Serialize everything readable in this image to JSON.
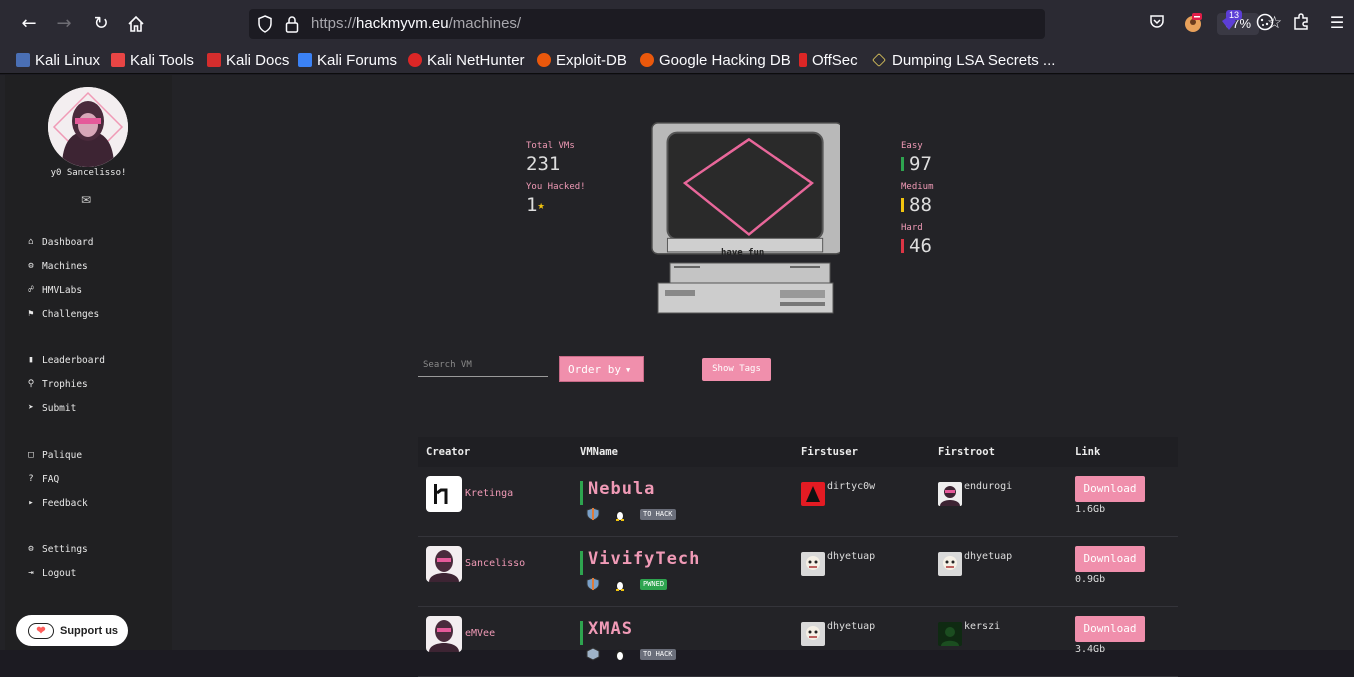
{
  "browser": {
    "url_scheme": "https://",
    "url_host": "hackmyvm.eu",
    "url_path": "/machines/",
    "zoom": "67%",
    "ext_badge": "13"
  },
  "bookmarks": [
    "Kali Linux",
    "Kali Tools",
    "Kali Docs",
    "Kali Forums",
    "Kali NetHunter",
    "Exploit-DB",
    "Google Hacking DB",
    "OffSec",
    "Dumping LSA Secrets ..."
  ],
  "sidebar": {
    "username": "y0 Sancelisso!",
    "nav": [
      "Dashboard",
      "Machines",
      "HMVLabs",
      "Challenges",
      "Leaderboard",
      "Trophies",
      "Submit",
      "Palique",
      "FAQ",
      "Feedback",
      "Settings",
      "Logout"
    ],
    "support": "Support us"
  },
  "stats": {
    "total_label": "Total VMs",
    "total": "231",
    "hacked_label": "You Hacked!",
    "hacked": "1",
    "easy_label": "Easy",
    "easy": "97",
    "medium_label": "Medium",
    "medium": "88",
    "hard_label": "Hard",
    "hard": "46",
    "monitor_text": "have fun"
  },
  "controls": {
    "search_placeholder": "Search VM",
    "order_by": "Order by",
    "show_tags": "Show Tags"
  },
  "table": {
    "headers": [
      "Creator",
      "VMName",
      "Firstuser",
      "Firstroot",
      "Link"
    ],
    "rows": [
      {
        "creator": "Kretinga",
        "vm": "Nebula",
        "tag": "TO HACK",
        "firstuser": "dirtyc0w",
        "firstroot": "endurogi",
        "download": "Download",
        "size": "1.6Gb"
      },
      {
        "creator": "Sancelisso",
        "vm": "VivifyTech",
        "tag": "PWNED",
        "firstuser": "dhyetuap",
        "firstroot": "dhyetuap",
        "download": "Download",
        "size": "0.9Gb"
      },
      {
        "creator": "eMVee",
        "vm": "XMAS",
        "tag": "TO HACK",
        "firstuser": "dhyetuap",
        "firstroot": "kerszi",
        "download": "Download",
        "size": "3.4Gb"
      }
    ]
  },
  "colors": {
    "accent": "#f08fac",
    "easy": "#2ea44f",
    "medium": "#f1c40f",
    "hard": "#dc3545"
  }
}
